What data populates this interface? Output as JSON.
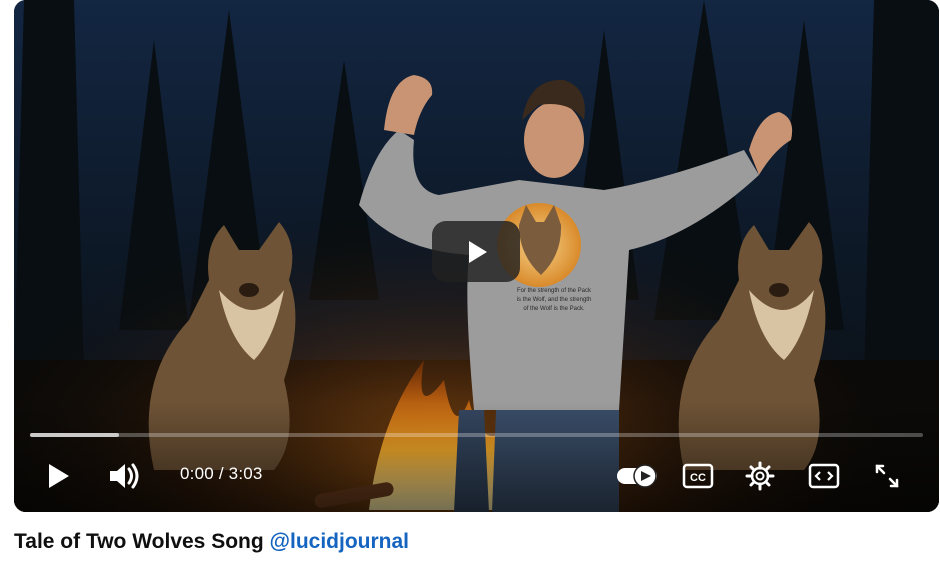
{
  "player": {
    "current_time": "0:00",
    "separator": " / ",
    "duration": "3:03",
    "progress": 0.1,
    "shirt_text": "For the strength of the Pack is the Wolf, and the strength of the Wolf is the Pack."
  },
  "caption": {
    "title": "Tale of Two Wolves Song ",
    "handle": "@lucidjournal"
  },
  "icons": [
    "play-icon",
    "volume-icon",
    "autoplay-toggle-icon",
    "cc-icon",
    "settings-icon",
    "embed-icon",
    "fullscreen-icon"
  ],
  "colors": {
    "link": "#1565c0",
    "fire": "#ff9a1f",
    "night_sky": "#14243e"
  }
}
